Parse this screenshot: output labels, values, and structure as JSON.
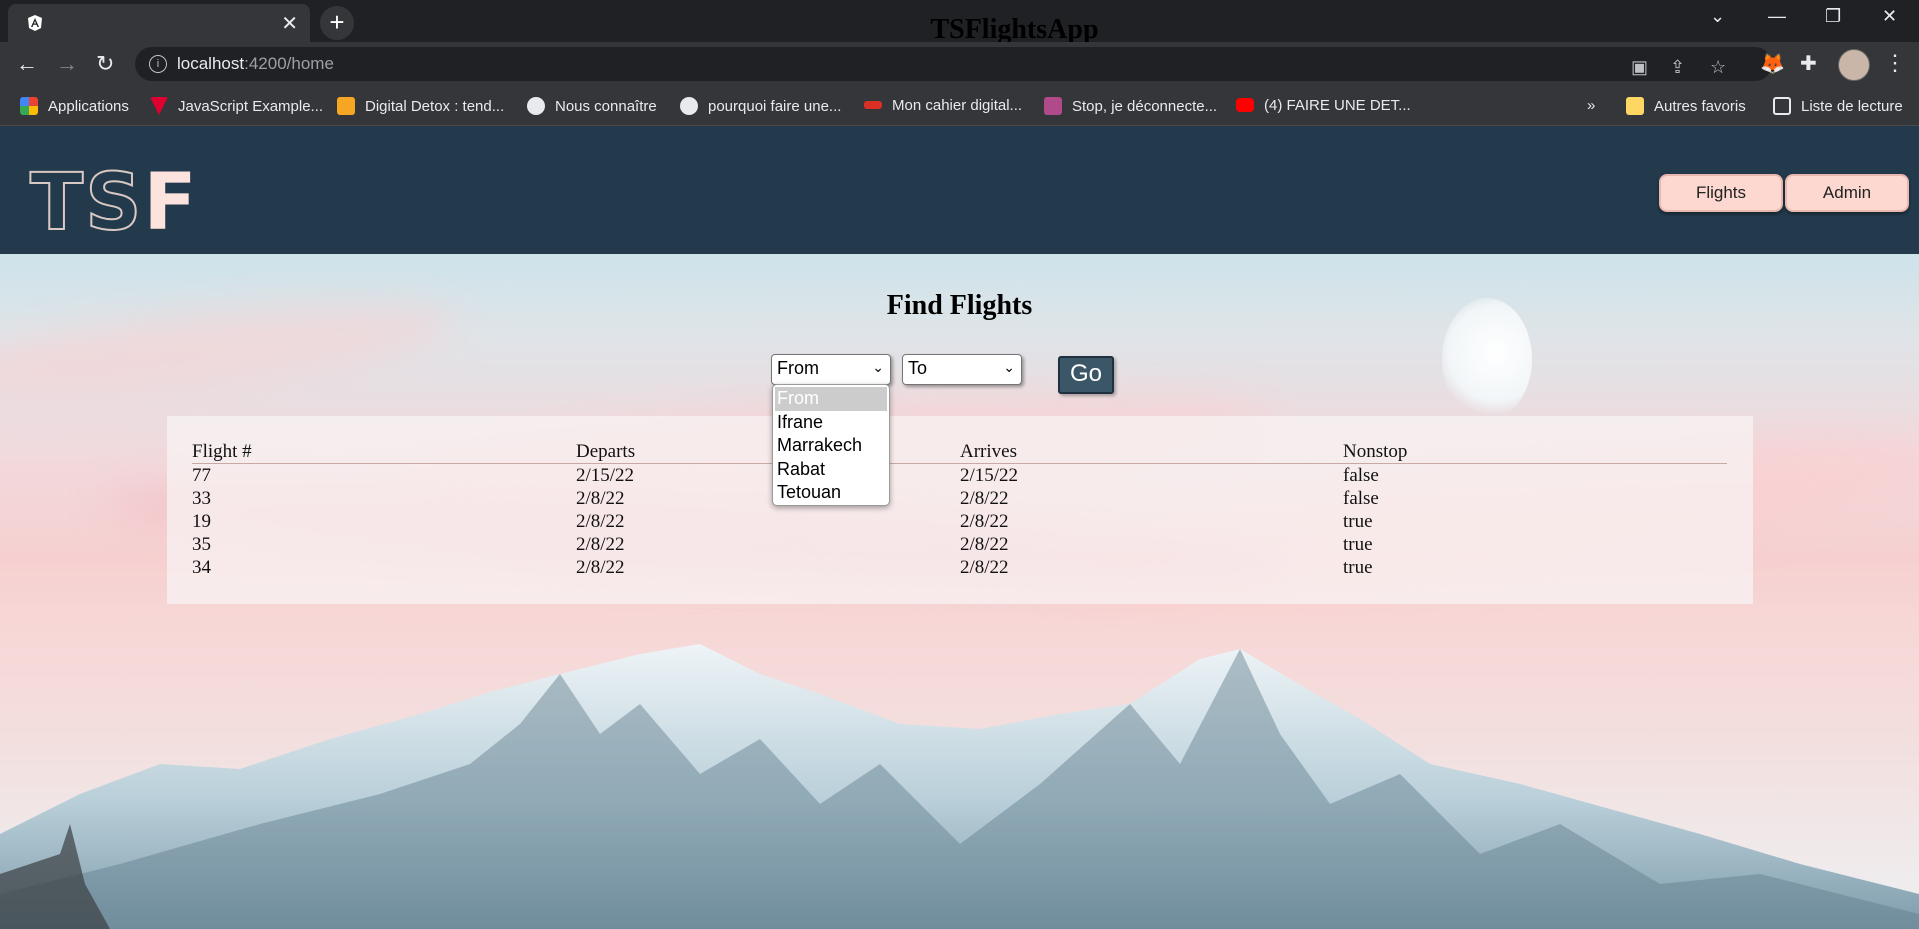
{
  "browser": {
    "tab_title": "TSFlightsApp",
    "url_host": "localhost",
    "url_path": ":4200/home",
    "bookmarks": [
      {
        "label": "Applications",
        "icon": "apps-grid-icon",
        "color": "#e94235"
      },
      {
        "label": "JavaScript Example...",
        "icon": "angular-icon",
        "color": "#dd0031"
      },
      {
        "label": "Digital Detox : tend...",
        "icon": "digital-detox-icon",
        "color": "#f6a623"
      },
      {
        "label": "Nous connaître",
        "icon": "globe-icon",
        "color": "#e8eaed"
      },
      {
        "label": "pourquoi faire une...",
        "icon": "globe-icon",
        "color": "#e8eaed"
      },
      {
        "label": "Mon cahier digital...",
        "icon": "cahier-icon",
        "color": "#d93025"
      },
      {
        "label": "Stop, je déconnecte...",
        "icon": "stop-icon",
        "color": "#b04a8a"
      },
      {
        "label": "(4) FAIRE UNE DET...",
        "icon": "youtube-icon",
        "color": "#ff0000"
      }
    ],
    "overflow": "»",
    "other_bookmarks": "Autres favoris",
    "reading_list": "Liste de lecture"
  },
  "app": {
    "logo": {
      "outline": "TS",
      "solid": "F"
    },
    "nav": {
      "flights": "Flights",
      "admin": "Admin"
    },
    "title": "Find Flights",
    "from_select": {
      "value": "From",
      "options": [
        "From",
        "Ifrane",
        "Marrakech",
        "Rabat",
        "Tetouan"
      ]
    },
    "to_select": {
      "value": "To"
    },
    "go_label": "Go",
    "table": {
      "headers": [
        "Flight #",
        "Departs",
        "Arrives",
        "Nonstop"
      ],
      "rows": [
        [
          "77",
          "2/15/22",
          "2/15/22",
          "false"
        ],
        [
          "33",
          "2/8/22",
          "2/8/22",
          "false"
        ],
        [
          "19",
          "2/8/22",
          "2/8/22",
          "true"
        ],
        [
          "35",
          "2/8/22",
          "2/8/22",
          "true"
        ],
        [
          "34",
          "2/8/22",
          "2/8/22",
          "true"
        ]
      ]
    }
  }
}
